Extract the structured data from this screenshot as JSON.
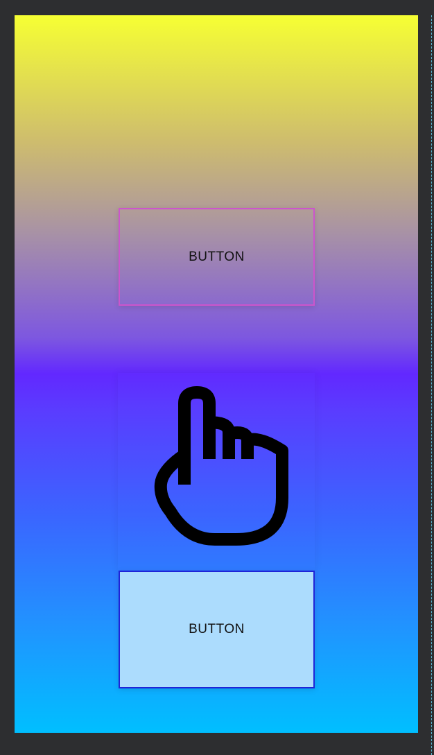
{
  "screen": {
    "top_button": {
      "label": "BUTTON",
      "border_color": "#cc55cc"
    },
    "image_button": {
      "icon": "touch-app-icon"
    },
    "bottom_button": {
      "label": "BUTTON",
      "background_color": "#acdcfd",
      "border_color": "#1f24d8"
    }
  },
  "colors": {
    "frame": "#2d2e30",
    "gradient_top": "#f6ff33",
    "gradient_middle": "#6228ff",
    "gradient_bottom": "#00bfff"
  }
}
